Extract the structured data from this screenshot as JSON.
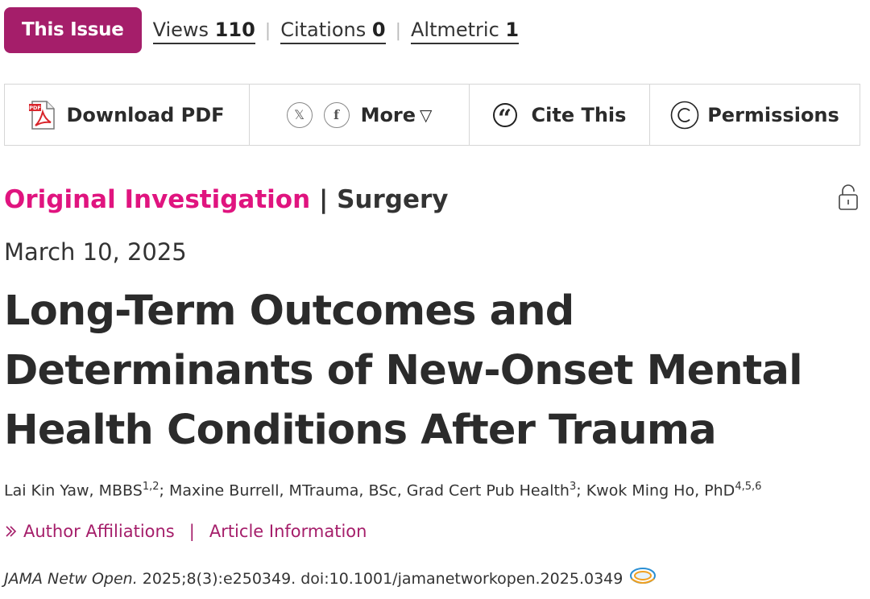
{
  "issue_button": "This Issue",
  "metrics": [
    {
      "label": "Views",
      "value": "110"
    },
    {
      "label": "Citations",
      "value": "0"
    },
    {
      "label": "Altmetric",
      "value": "1"
    }
  ],
  "toolbar": {
    "download_pdf": "Download PDF",
    "more": "More",
    "cite": "Cite This",
    "permissions": "Permissions"
  },
  "article": {
    "type": "Original Investigation",
    "separator": "|",
    "section": "Surgery",
    "date": "March 10, 2025",
    "title": "Long-Term Outcomes and Determinants of New-Onset Mental Health Conditions After Trauma",
    "authors": [
      {
        "name": "Lai Kin Yaw, MBBS",
        "sup": "1,2",
        "after": "; "
      },
      {
        "name": "Maxine Burrell, MTrauma, BSc, Grad Cert Pub Health",
        "sup": "3",
        "after": "; "
      },
      {
        "name": "Kwok Ming Ho, PhD",
        "sup": "4,5,6",
        "after": ""
      }
    ],
    "author_affiliations": "Author Affiliations",
    "links_separator": "|",
    "article_information": "Article Information",
    "journal": "JAMA Netw Open.",
    "citation": " 2025;8(3):e250349. doi:10.1001/jamanetworkopen.2025.0349"
  },
  "colors": {
    "accent": "#a51e6a",
    "category": "#e0147f",
    "text": "#2b2b2b"
  }
}
